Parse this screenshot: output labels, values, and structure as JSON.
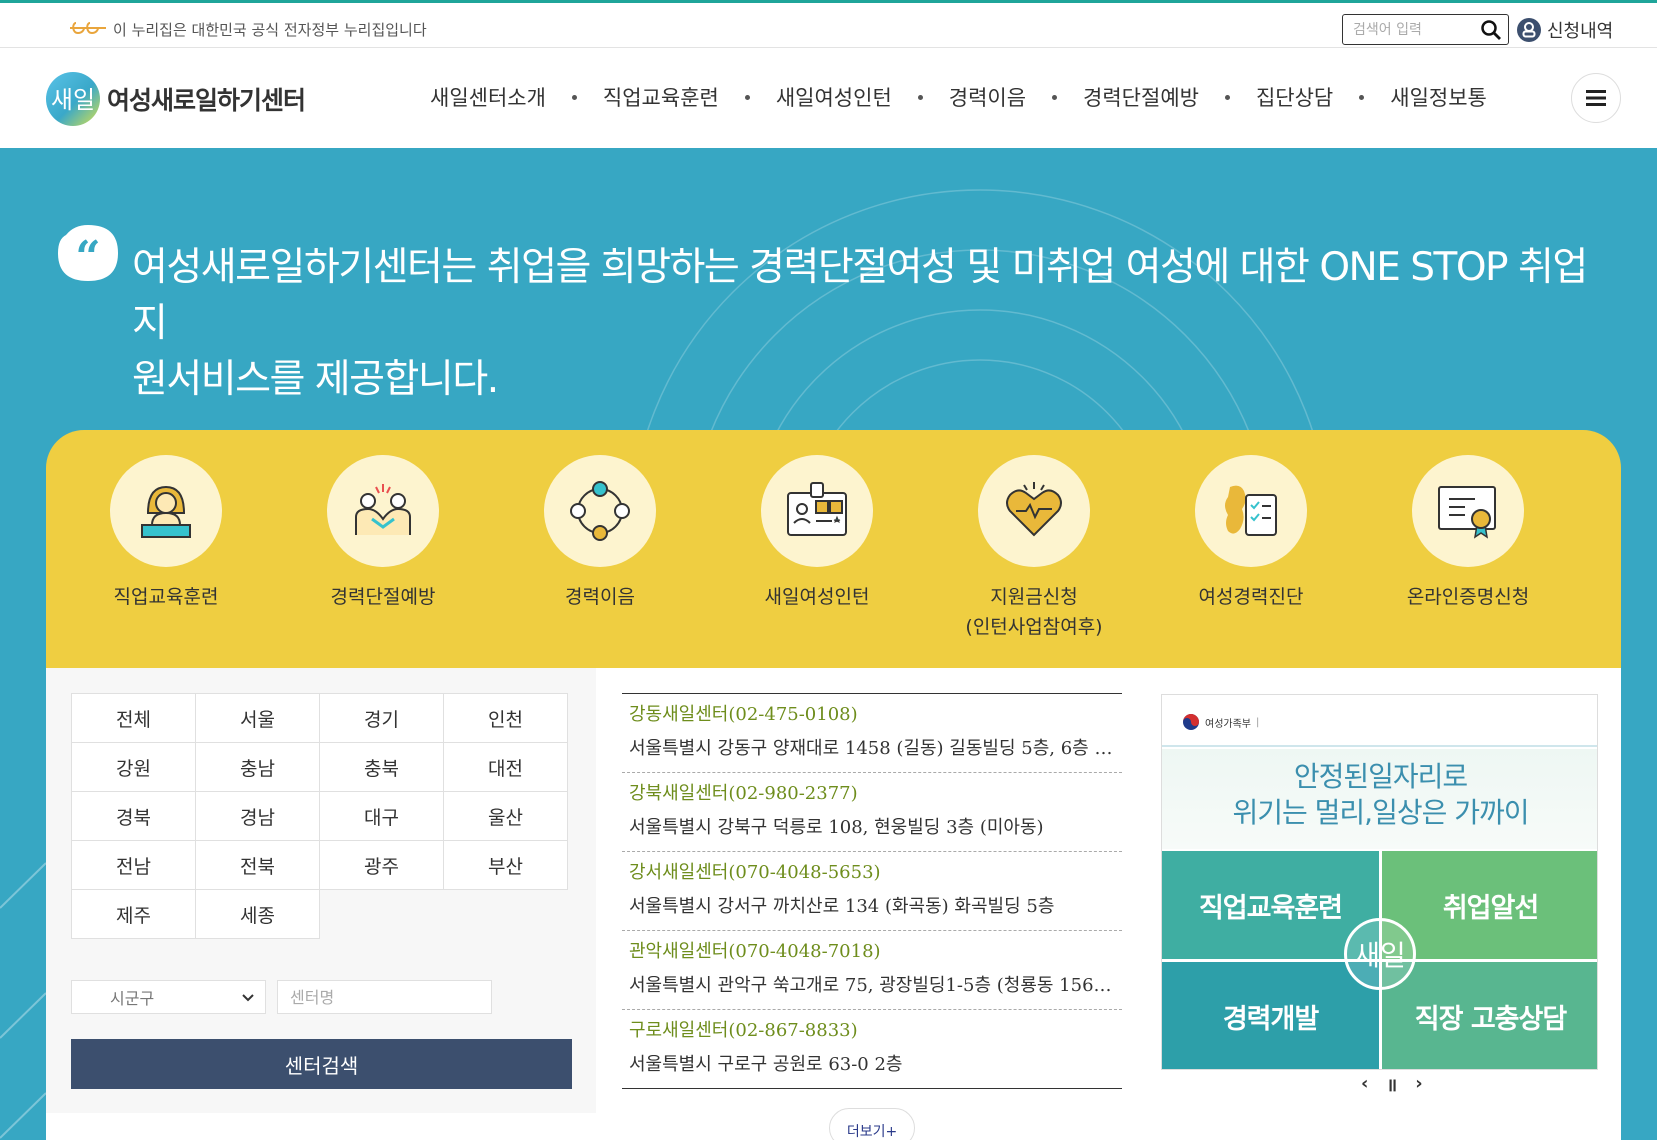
{
  "gov_bar": {
    "notice": "이 누리집은 대한민국 공식 전자정부 누리집입니다",
    "search_placeholder": "검색어 입력",
    "apply_label": "신청내역"
  },
  "header": {
    "logo_text": "여성새로일하기센터",
    "nav": [
      "새일센터소개",
      "직업교육훈련",
      "새일여성인턴",
      "경력이음",
      "경력단절예방",
      "집단상담",
      "새일정보통"
    ]
  },
  "hero": {
    "line1": "여성새로일하기센터는 취업을 희망하는 경력단절여성 및 미취업 여성에 대한 ONE STOP 취업지",
    "line2": "원서비스를 제공합니다."
  },
  "quick_menu": [
    {
      "label": "직업교육훈련",
      "label2": "",
      "icon": "teacher-icon"
    },
    {
      "label": "경력단절예방",
      "label2": "",
      "icon": "handshake-icon"
    },
    {
      "label": "경력이음",
      "label2": "",
      "icon": "people-circle-icon"
    },
    {
      "label": "새일여성인턴",
      "label2": "",
      "icon": "id-card-icon"
    },
    {
      "label": "지원금신청",
      "label2": "(인턴사업참여후)",
      "icon": "heart-icon"
    },
    {
      "label": "여성경력진단",
      "label2": "",
      "icon": "checklist-map-icon"
    },
    {
      "label": "온라인증명신청",
      "label2": "",
      "icon": "certificate-icon"
    }
  ],
  "regions": [
    "전체",
    "서울",
    "경기",
    "인천",
    "강원",
    "충남",
    "충북",
    "대전",
    "경북",
    "경남",
    "대구",
    "울산",
    "전남",
    "전북",
    "광주",
    "부산",
    "제주",
    "세종"
  ],
  "filters": {
    "select_value": "시군구",
    "center_placeholder": "센터명",
    "search_button": "센터검색"
  },
  "centers": [
    {
      "name": "강동새일센터(02-475-0108)",
      "address": "서울특별시 강동구 양재대로 1458 (길동) 길동빌딩 5층, 6층 (…"
    },
    {
      "name": "강북새일센터(02-980-2377)",
      "address": "서울특별시 강북구 덕릉로 108, 현웅빌딩 3층 (미아동)"
    },
    {
      "name": "강서새일센터(070-4048-5653)",
      "address": "서울특별시 강서구 까치산로 134 (화곡동) 화곡빌딩 5층"
    },
    {
      "name": "관악새일센터(070-4048-7018)",
      "address": "서울특별시 관악구 쑥고개로 75, 광장빌딩1-5층 (청룡동 156…"
    },
    {
      "name": "구로새일센터(02-867-8833)",
      "address": "서울특별시 구로구 공원로 63-0 2층"
    }
  ],
  "more_label": "더보기+",
  "banner": {
    "ministry": "여성가족부",
    "line1": "안정된일자리로",
    "line2": "위기는 멀리,일상은 가까이",
    "cells": [
      "직업교육훈련",
      "취업알선",
      "경력개발",
      "직장 고충상담"
    ],
    "center_label": "새일"
  },
  "colors": {
    "hero_bg": "#37a7c3",
    "quick_bg": "#efce41",
    "search_btn": "#3c4f6e",
    "center_name": "#6e8d1c"
  }
}
